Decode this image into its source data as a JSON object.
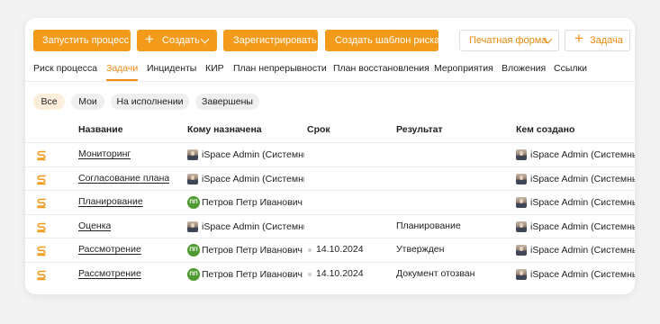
{
  "toolbar": {
    "start_process": "Запустить процесс",
    "create": "Создать",
    "register": "Зарегистрировать",
    "create_risk_template": "Создать шаблон риска",
    "print_form": "Печатная форма",
    "task": "Задача"
  },
  "tabs": [
    "Риск процесса",
    "Задачи",
    "Инциденты",
    "КИР",
    "План непрерывности",
    "План восстановления",
    "Мероприятия",
    "Вложения",
    "Ссылки"
  ],
  "active_tab": "Задачи",
  "filters": [
    "Все",
    "Мои",
    "На исполнении",
    "Завершены"
  ],
  "active_filter": "Все",
  "columns": {
    "name": "Название",
    "assigned": "Кому назначена",
    "deadline": "Срок",
    "result": "Результат",
    "created_by": "Кем создано"
  },
  "rows": [
    {
      "name": "Мониторинг",
      "assignee": "iSpace Admin (Системный",
      "assignee_type": "photo",
      "deadline": "",
      "result": "",
      "creator": "iSpace Admin (Системный"
    },
    {
      "name": "Согласование плана",
      "assignee": "iSpace Admin (Системный",
      "assignee_type": "photo",
      "deadline": "",
      "result": "",
      "creator": "iSpace Admin (Системный"
    },
    {
      "name": "Планирование",
      "assignee": "Петров Петр Иванович (С",
      "assignee_type": "initials",
      "initials": "ПП",
      "deadline": "",
      "result": "",
      "creator": "iSpace Admin (Системный"
    },
    {
      "name": "Оценка",
      "assignee": "iSpace Admin (Системный",
      "assignee_type": "photo",
      "deadline": "",
      "result": "Планирование",
      "creator": "iSpace Admin (Системный"
    },
    {
      "name": "Рассмотрение",
      "assignee": "Петров Петр Иванович (С",
      "assignee_type": "initials",
      "initials": "ПП",
      "deadline": "14.10.2024",
      "result": "Утвержден",
      "creator": "iSpace Admin (Системный"
    },
    {
      "name": "Рассмотрение",
      "assignee": "Петров Петр Иванович (С",
      "assignee_type": "initials",
      "initials": "ПП",
      "deadline": "14.10.2024",
      "result": "Документ отозван",
      "creator": "iSpace Admin (Системный"
    }
  ],
  "row_icon": "task-process-icon",
  "colors": {
    "accent": "#f39a1a",
    "accent_text": "#ef8a12",
    "chip_active": "#fdeedc",
    "avatar_green": "#4e9a2e"
  }
}
